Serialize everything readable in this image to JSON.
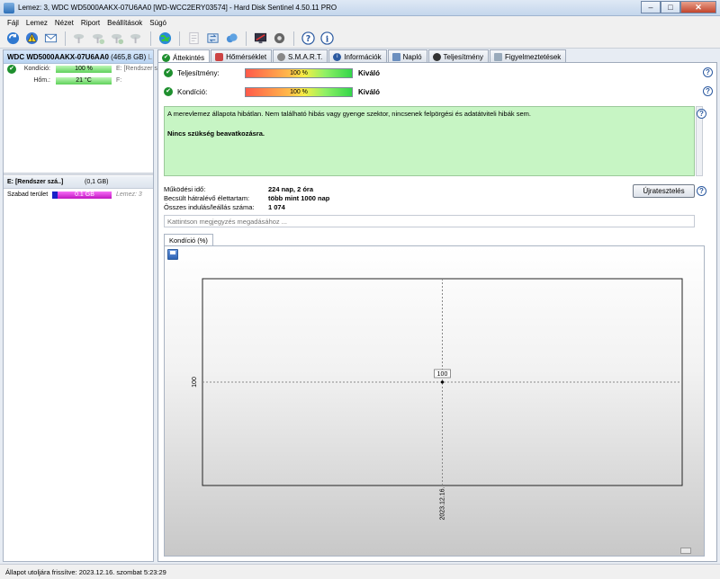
{
  "window": {
    "title": "Lemez: 3, WDC WD5000AAKX-07U6AA0 [WD-WCC2ERY03574]  -  Hard Disk Sentinel 4.50.11 PRO",
    "minimize": "–",
    "maximize": "□",
    "close": "✕"
  },
  "menu": [
    "Fájl",
    "Lemez",
    "Nézet",
    "Riport",
    "Beállítások",
    "Súgó"
  ],
  "toolbar": {
    "icons": [
      "refresh-icon",
      "warning-icon",
      "mail-icon",
      "disk-tool-icon",
      "disk-tool2-icon",
      "disk-tool3-icon",
      "disk-tool4-icon",
      "globe-icon",
      "document-icon",
      "transfer-icon",
      "cloud-icon",
      "monitor-icon",
      "settings-icon",
      "help-icon",
      "info-icon"
    ]
  },
  "left": {
    "disk_name": "WDC WD5000AAKX-07U6AA0",
    "disk_size": "(465,8 GB)",
    "disk_num": "L",
    "condition_label": "Kondíció:",
    "condition_value": "100 %",
    "condition_drive": "E: [Rendszer s",
    "temp_label": "Hőm.:",
    "temp_value": "21 °C",
    "temp_drive": "F:",
    "partition_name": "E: [Rendszer szá..]",
    "partition_size": "(0,1 GB)",
    "free_label": "Szabad terület",
    "free_value": "0.1 GB",
    "free_disk": "Lemez: 3"
  },
  "tabs": [
    "Áttekintés",
    "Hőmérséklet",
    "S.M.A.R.T.",
    "Információk",
    "Napló",
    "Teljesítmény",
    "Figyelmeztetések"
  ],
  "summary": {
    "performance_label": "Teljesítmény:",
    "performance_value": "100 %",
    "performance_rating": "Kiváló",
    "performance_fraction": 1.0,
    "condition_label": "Kondíció:",
    "condition_value": "100 %",
    "condition_rating": "Kiváló",
    "condition_fraction": 1.0,
    "help": "?"
  },
  "message": {
    "line1": "A merevlemez állapota hibátlan. Nem található hibás vagy gyenge szektor, nincsenek felpörgési és adatátviteli hibák sem.",
    "line2": "Nincs szükség beavatkozásra."
  },
  "info": {
    "uptime_label": "Működési idő:",
    "uptime_value": "224 nap, 2 óra",
    "lifetime_label": "Becsült hátralévő élettartam:",
    "lifetime_value": "több mint 1000 nap",
    "startstop_label": "Összes indulás/leállás száma:",
    "startstop_value": "1 074"
  },
  "retest_button": "Újratesztelés",
  "note_placeholder": "Kattintson megjegyzés megadásához ...",
  "chart_tab": "Kondíció  (%)",
  "chart_data": {
    "type": "scatter",
    "x": [
      "2023.12.16."
    ],
    "values": [
      100
    ],
    "point_label": "100",
    "y_tick": "100",
    "x_tick": "2023.12.16.",
    "grid": true
  },
  "statusbar": "Állapot utoljára frissítve: 2023.12.16. szombat 5:23:29"
}
